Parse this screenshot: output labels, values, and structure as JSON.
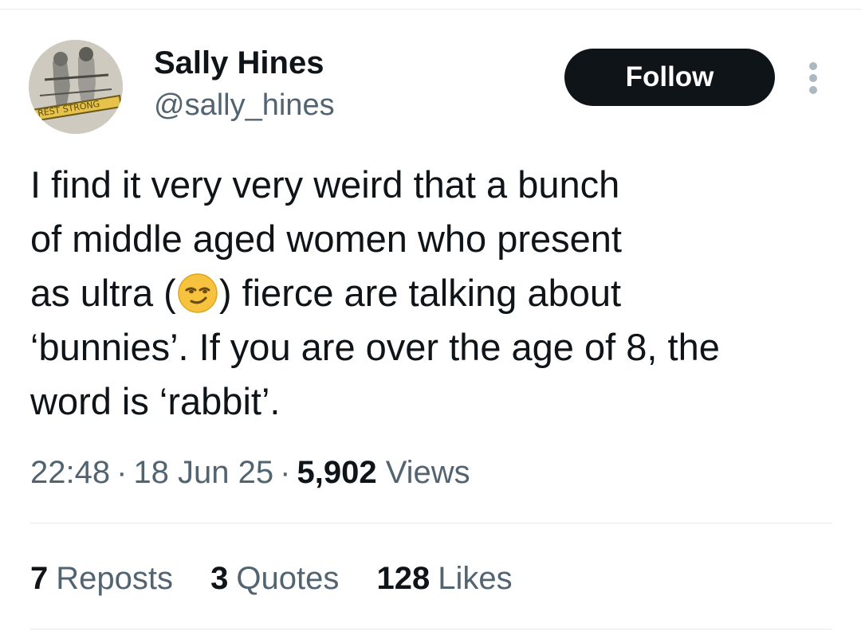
{
  "author": {
    "display_name": "Sally Hines",
    "handle": "@sally_hines",
    "avatar_banner_text": "REST STRONG"
  },
  "actions": {
    "follow_label": "Follow",
    "more_icon": "more-vertical-icon"
  },
  "tweet": {
    "lines": [
      {
        "text": "I find it very very weird that a bunch"
      },
      {
        "text": "of middle aged women who present"
      },
      {
        "before": "as ultra (",
        "emoji": "smirking-face-emoji",
        "after": ") fierce are talking about"
      },
      {
        "text": "‘bunnies’. If you are over the age of 8, the"
      },
      {
        "text": "word is ‘rabbit’."
      }
    ]
  },
  "meta": {
    "time": "22:48",
    "separator": "·",
    "date": "18 Jun 25",
    "views_count": "5,902",
    "views_label": "Views"
  },
  "stats": {
    "reposts_count": "7",
    "reposts_label": "Reposts",
    "quotes_count": "3",
    "quotes_label": "Quotes",
    "likes_count": "128",
    "likes_label": "Likes"
  },
  "colors": {
    "text_primary": "#0f1419",
    "text_secondary": "#536471",
    "follow_bg": "#0f1419",
    "divider": "#e7e9ea"
  }
}
